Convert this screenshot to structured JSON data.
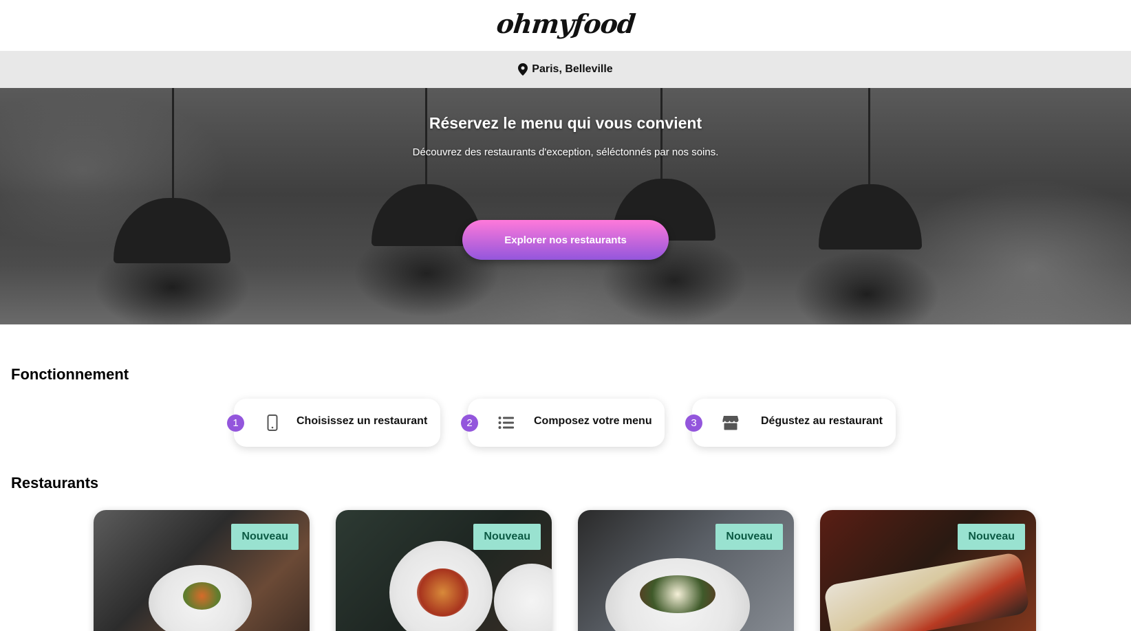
{
  "header": {
    "logo_text": "ohmyfood"
  },
  "location": {
    "icon": "map-pin-icon",
    "text": "Paris, Belleville"
  },
  "hero": {
    "title": "Réservez le menu qui vous convient",
    "subtitle": "Découvrez des restaurants d'exception, séléctonnés par nos soins.",
    "cta_label": "Explorer nos restaurants"
  },
  "howto": {
    "title": "Fonctionnement",
    "steps": [
      {
        "number": "1",
        "icon": "smartphone-icon",
        "label": "Choisissez un restaurant"
      },
      {
        "number": "2",
        "icon": "list-icon",
        "label": "Composez votre menu"
      },
      {
        "number": "3",
        "icon": "store-icon",
        "label": "Dégustez au restaurant"
      }
    ]
  },
  "restaurants": {
    "title": "Restaurants",
    "cards": [
      {
        "badge": "Nouveau"
      },
      {
        "badge": "Nouveau"
      },
      {
        "badge": "Nouveau"
      },
      {
        "badge": "Nouveau"
      }
    ]
  },
  "colors": {
    "accent_purple": "#9356dc",
    "accent_pink": "#ff79da",
    "badge_bg": "#99e2d0",
    "badge_text": "#0c5a44",
    "location_bar_bg": "#e8e8e8"
  }
}
